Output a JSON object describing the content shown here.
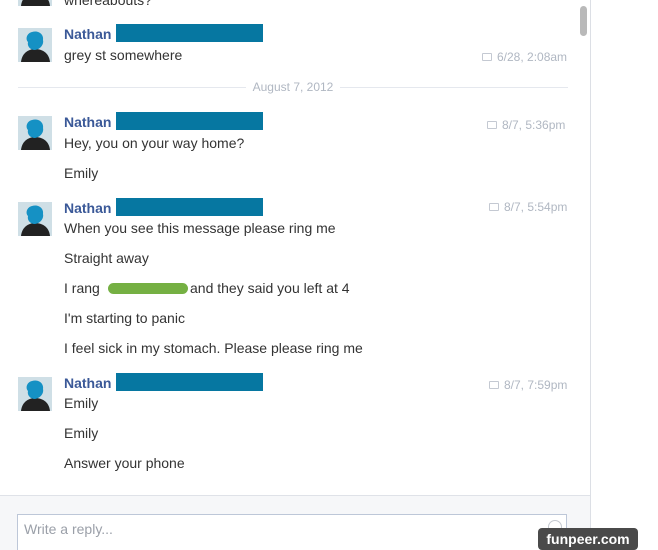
{
  "thread": {
    "top_fragment": "whereabouts?",
    "date_divider": "August 7, 2012",
    "groups": [
      {
        "sender": "Nathan",
        "timestamp": "6/28, 2:08am",
        "messages": [
          "grey st somewhere"
        ]
      },
      {
        "sender": "Nathan",
        "timestamp": "8/7, 5:36pm",
        "messages": [
          "Hey, you on your way home?",
          "Emily"
        ]
      },
      {
        "sender": "Nathan",
        "timestamp": "8/7, 5:54pm",
        "messages": [
          "When you see this message please ring me",
          "Straight away",
          "I rang",
          "and they said you left at 4",
          "I'm starting to panic",
          "I feel sick in my stomach. Please please ring me"
        ]
      },
      {
        "sender": "Nathan",
        "timestamp": "8/7, 7:59pm",
        "messages": [
          "Emily",
          "Emily",
          "Answer your phone"
        ]
      }
    ]
  },
  "reply": {
    "placeholder": "Write a reply..."
  },
  "watermark": "funpeer.com",
  "colors": {
    "sender": "#3b5998",
    "redaction": "#0677a1",
    "scribble": "#75b043",
    "timestamp": "#b0b7c2"
  },
  "icons": {
    "message_bubble": "speech-bubble-icon",
    "reply_emoji": "smiley-icon"
  }
}
